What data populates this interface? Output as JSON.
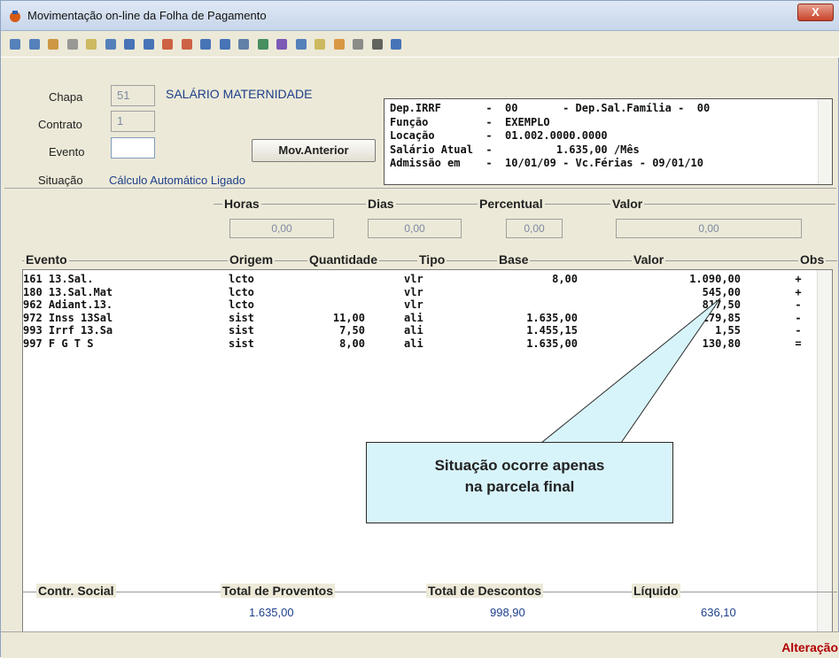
{
  "window": {
    "title": "Movimentação on-line da Folha de Pagamento",
    "close_label": "X"
  },
  "toolbar": {
    "icons": [
      "gear-icon",
      "save-icon",
      "edit-icon",
      "move-icon",
      "down-arrow-icon",
      "preview-icon",
      "prev-icon",
      "next-icon",
      "user-add-icon",
      "user-remove-icon",
      "equals-icon",
      "crosshair-icon",
      "calculator-icon",
      "grid-icon",
      "filter-icon",
      "form-icon",
      "tools-icon",
      "pencil-icon",
      "document-icon",
      "globe-icon",
      "help-icon"
    ]
  },
  "header": {
    "chapa_label": "Chapa",
    "chapa_value": "51",
    "chapa_name": "SALÁRIO MATERNIDADE",
    "contrato_label": "Contrato",
    "contrato_value": "1",
    "evento_label": "Evento",
    "evento_value": "",
    "mov_anterior_label": "Mov.Anterior",
    "situacao_label": "Situação",
    "situacao_value": "Cálculo Automático Ligado",
    "info_lines": [
      "Dep.IRRF       -  00       - Dep.Sal.Família -  00",
      "Função         -  EXEMPLO",
      "Locação        -  01.002.0000.0000",
      "Salário Atual  -          1.635,00 /Mês",
      "Admissão em    -  10/01/09 - Vc.Férias - 09/01/10"
    ]
  },
  "inputs": {
    "horas_label": "Horas",
    "horas_value": "0,00",
    "dias_label": "Dias",
    "dias_value": "0,00",
    "percentual_label": "Percentual",
    "percentual_value": "0,00",
    "valor_label": "Valor",
    "valor_value": "0,00"
  },
  "grid": {
    "headers": [
      "Evento",
      "Origem",
      "Quantidade",
      "Tipo",
      "Base",
      "Valor",
      "Obs"
    ],
    "rows": [
      [
        "161 13.Sal.",
        "lcto",
        "",
        "vlr",
        "8,00",
        "1.090,00",
        "+"
      ],
      [
        "180 13.Sal.Mat",
        "lcto",
        "",
        "vlr",
        "",
        "545,00",
        "+"
      ],
      [
        "962 Adiant.13.",
        "lcto",
        "",
        "vlr",
        "",
        "817,50",
        "-"
      ],
      [
        "972 Inss 13Sal",
        "sist",
        "11,00",
        "ali",
        "1.635,00",
        "179,85",
        "-"
      ],
      [
        "993 Irrf 13.Sa",
        "sist",
        "7,50",
        "ali",
        "1.455,15",
        "1,55",
        "-"
      ],
      [
        "997 F G T S",
        "sist",
        "8,00",
        "ali",
        "1.635,00",
        "130,80",
        "="
      ]
    ]
  },
  "totals": {
    "contr_social_label": "Contr. Social",
    "proventos_label": "Total de Proventos",
    "proventos_value": "1.635,00",
    "descontos_label": "Total de Descontos",
    "descontos_value": "998,90",
    "liquido_label": "Líquido",
    "liquido_value": "636,10"
  },
  "status": {
    "mode": "Alteração"
  },
  "callout": {
    "line1": "Situação ocorre apenas",
    "line2": "na parcela final"
  }
}
